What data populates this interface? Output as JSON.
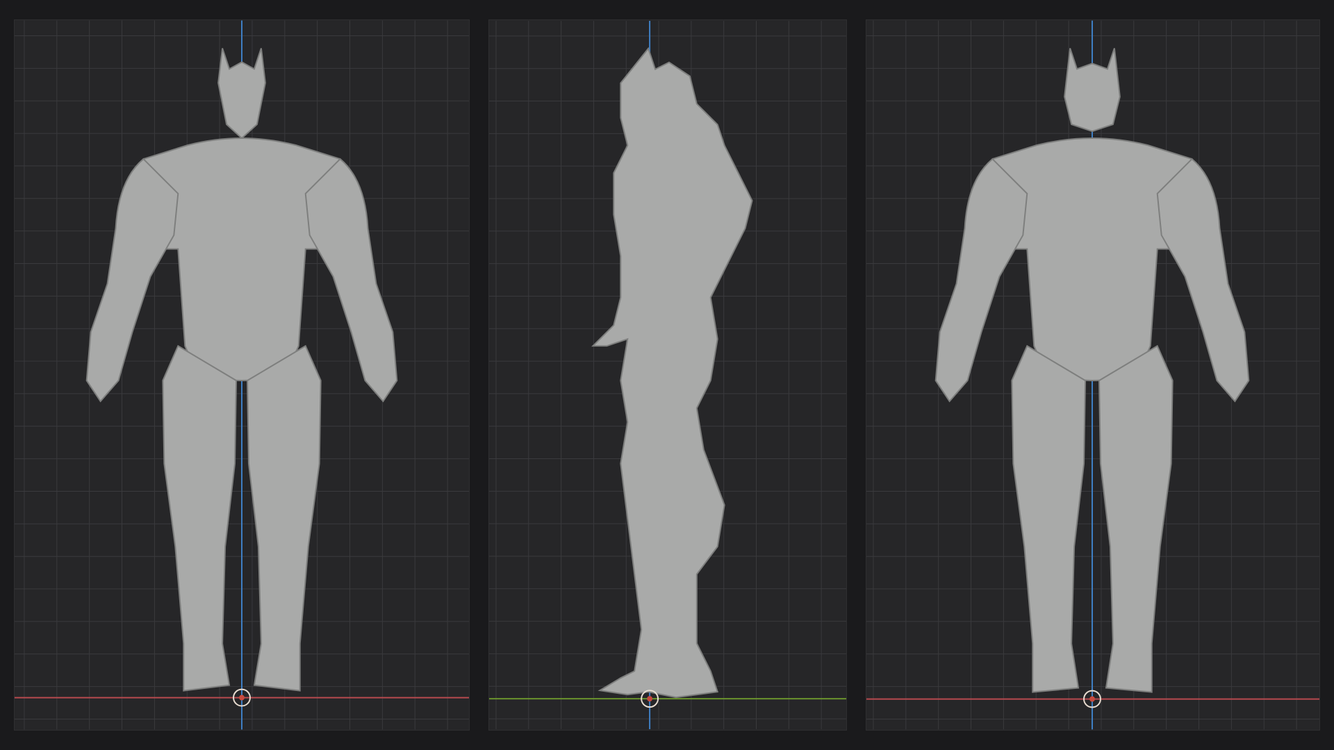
{
  "viewports": [
    {
      "id": "front",
      "view": "front",
      "ground_axis_color": "#b84a4f",
      "vertical_axis_color": "#3f7fc4"
    },
    {
      "id": "side",
      "view": "side",
      "ground_axis_color": "#6f9a2e",
      "vertical_axis_color": "#3f7fc4"
    },
    {
      "id": "back",
      "view": "back",
      "ground_axis_color": "#b84a4f",
      "vertical_axis_color": "#3f7fc4"
    }
  ],
  "colors": {
    "background": "#1a1a1c",
    "viewport_bg": "#262628",
    "grid_line": "#3a3a3d",
    "model": "#a9aaa9",
    "origin_marker": "#e8dcd0",
    "origin_marker_ring": "#c84a3e"
  },
  "model": {
    "name_icon": "creature-sculpt-icon"
  }
}
